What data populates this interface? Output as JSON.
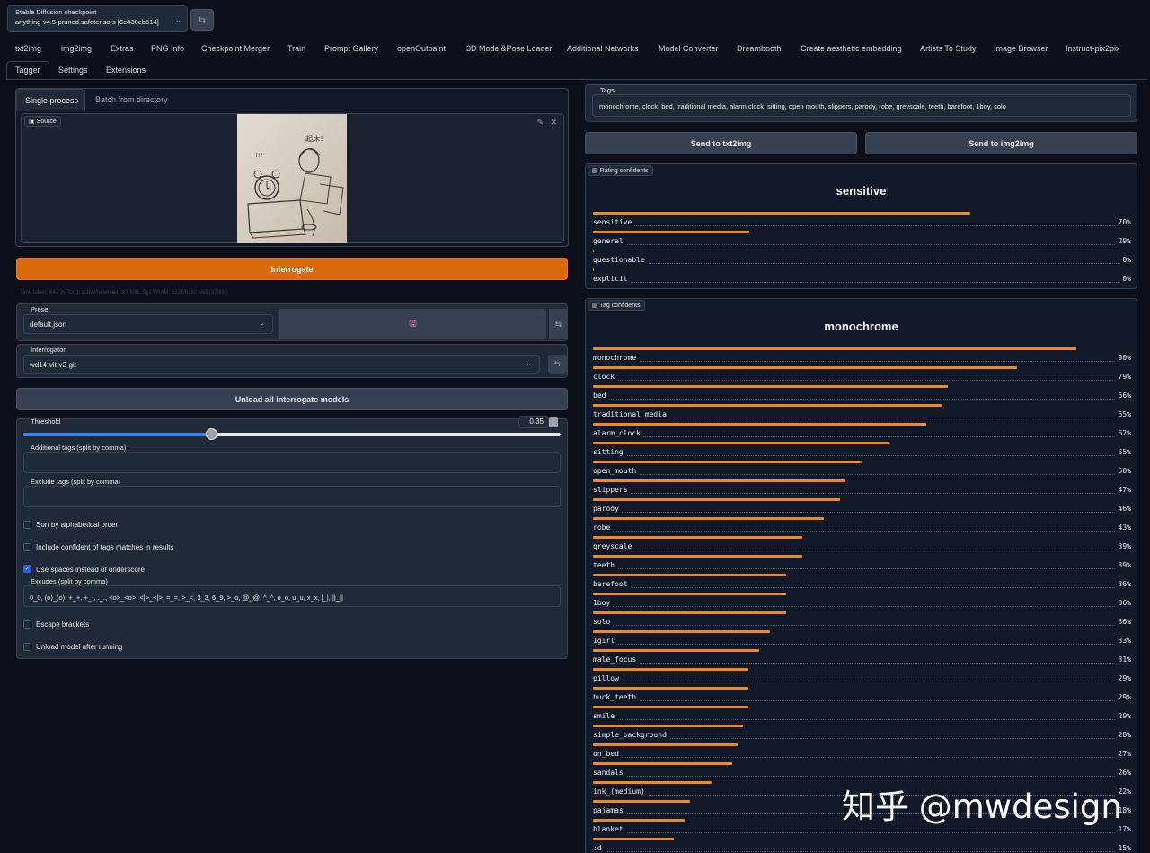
{
  "checkpoint": {
    "label": "Stable Diffusion checkpoint",
    "value": "anything-v4.5-pruned.safetensors [6e430eb514]"
  },
  "main_tabs": [
    "txt2img",
    "img2img",
    "Extras",
    "PNG Info",
    "Checkpoint Merger",
    "Train",
    "Prompt Gallery",
    "openOutpaint",
    "3D Model&Pose Loader",
    "Additional Networks",
    "Model Converter",
    "Dreambooth",
    "Create aesthetic embedding",
    "Artists To Study",
    "Image Browser",
    "Instruct-pix2pix"
  ],
  "sub_tabs": [
    "Tagger",
    "Settings",
    "Extensions"
  ],
  "left": {
    "mode_tabs": [
      "Single process",
      "Batch from directory"
    ],
    "source_label": "Source",
    "interrogate_label": "Interrogate",
    "time_text": "Time taken: 44.73s  Torch active/reserved: 3/3 MiB, Sys VRAM: 3227/8192 MiB (37.8%)",
    "preset_label": "Preset",
    "preset_value": "default.json",
    "interrogator_label": "Interrogator",
    "interrogator_value": "wd14-vit-v2-git",
    "unload_label": "Unload all interrogate models",
    "threshold_label": "Threshold",
    "threshold_value": "0.35",
    "threshold_fraction": 0.35,
    "additional_tags_label": "Additional tags (split by comma)",
    "exclude_tags_label": "Exclude tags (split by comma)",
    "sort_label": "Sort by alphabetical order",
    "include_conf_label": "Include confident of tags matches in results",
    "use_spaces_label": "Use spaces instead of underscore",
    "excudes_label": "Excudes (split by comma)",
    "excudes_value": "0_0, (o)_(o), +_+, +_-, ._., <o>_<o>, <|>_<|>, =_=, >_<, 3_3, 6_9, >_o, @_@, ^_^, o_o, u_u, x_x, |_|, ||_||",
    "escape_label": "Escape brackets",
    "unload_after_label": "Unload model after running"
  },
  "right": {
    "tags_label": "Tags",
    "tags_value": "monochrome, clock, bed, traditional media, alarm clock, sitting, open mouth, slippers, parody, robe, greyscale, teeth, barefoot, 1boy, solo",
    "send_txt2img": "Send to txt2img",
    "send_img2img": "Send to img2img",
    "rating_label": "Rating confidents",
    "rating_title": "sensitive",
    "tag_label": "Tag confidents",
    "tag_title": "monochrome"
  },
  "ratings": [
    {
      "name": "sensitive",
      "pct": "70%",
      "value": 0.7
    },
    {
      "name": "general",
      "pct": "29%",
      "value": 0.29
    },
    {
      "name": "questionable",
      "pct": "0%",
      "value": 0.0
    },
    {
      "name": "explicit",
      "pct": "0%",
      "value": 0.0
    }
  ],
  "tags": [
    {
      "name": "monochrome",
      "pct": "90%",
      "value": 0.9
    },
    {
      "name": "clock",
      "pct": "79%",
      "value": 0.79
    },
    {
      "name": "bed",
      "pct": "66%",
      "value": 0.66
    },
    {
      "name": "traditional_media",
      "pct": "65%",
      "value": 0.65
    },
    {
      "name": "alarm_clock",
      "pct": "62%",
      "value": 0.62
    },
    {
      "name": "sitting",
      "pct": "55%",
      "value": 0.55
    },
    {
      "name": "open_mouth",
      "pct": "50%",
      "value": 0.5
    },
    {
      "name": "slippers",
      "pct": "47%",
      "value": 0.47
    },
    {
      "name": "parody",
      "pct": "46%",
      "value": 0.46
    },
    {
      "name": "robe",
      "pct": "43%",
      "value": 0.43
    },
    {
      "name": "greyscale",
      "pct": "39%",
      "value": 0.39
    },
    {
      "name": "teeth",
      "pct": "39%",
      "value": 0.39
    },
    {
      "name": "barefoot",
      "pct": "36%",
      "value": 0.36
    },
    {
      "name": "1boy",
      "pct": "36%",
      "value": 0.36
    },
    {
      "name": "solo",
      "pct": "36%",
      "value": 0.36
    },
    {
      "name": "1girl",
      "pct": "33%",
      "value": 0.33
    },
    {
      "name": "male_focus",
      "pct": "31%",
      "value": 0.31
    },
    {
      "name": "pillow",
      "pct": "29%",
      "value": 0.29
    },
    {
      "name": "buck_teeth",
      "pct": "29%",
      "value": 0.29
    },
    {
      "name": "smile",
      "pct": "29%",
      "value": 0.29
    },
    {
      "name": "simple_background",
      "pct": "28%",
      "value": 0.28
    },
    {
      "name": "on_bed",
      "pct": "27%",
      "value": 0.27
    },
    {
      "name": "sandals",
      "pct": "26%",
      "value": 0.26
    },
    {
      "name": "ink_(medium)",
      "pct": "22%",
      "value": 0.22
    },
    {
      "name": "pajamas",
      "pct": "18%",
      "value": 0.18
    },
    {
      "name": "blanket",
      "pct": "17%",
      "value": 0.17
    },
    {
      "name": ":d",
      "pct": "15%",
      "value": 0.15
    }
  ],
  "watermark": "知乎 @mwdesign"
}
